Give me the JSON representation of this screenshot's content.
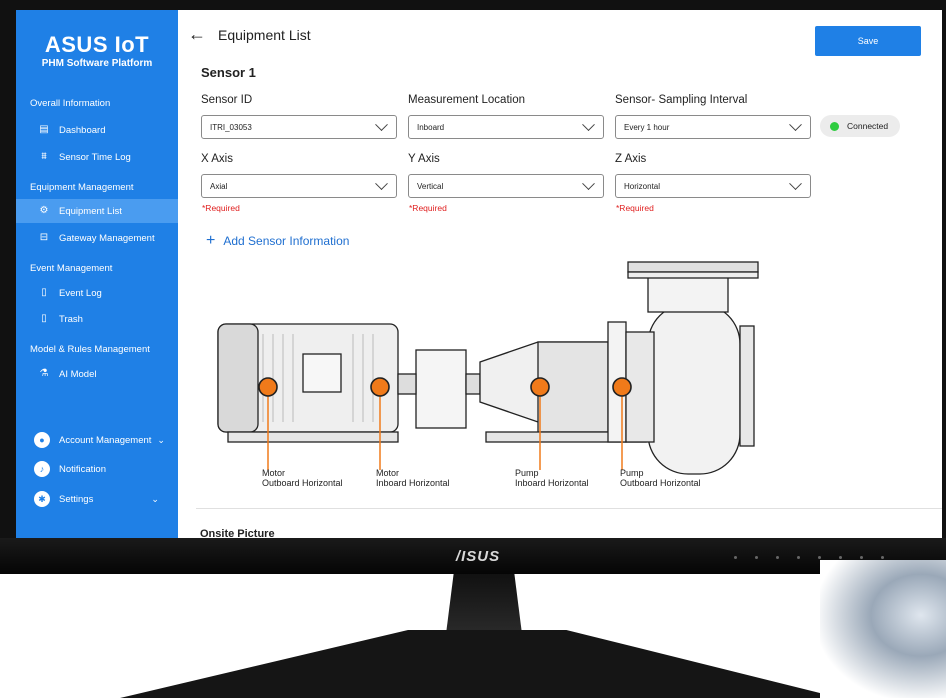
{
  "brand": {
    "name": "ASUS IoT",
    "subtitle": "PHM Software Platform"
  },
  "sidebar": {
    "sections": [
      {
        "title": "Overall Information"
      },
      {
        "title": "Equipment Management"
      },
      {
        "title": "Event Management"
      },
      {
        "title": "Model & Rules Management"
      }
    ],
    "items": [
      {
        "label": "Dashboard",
        "icon": "dashboard-icon"
      },
      {
        "label": "Sensor Time Log",
        "icon": "sensor-log-icon"
      },
      {
        "label": "Equipment List",
        "icon": "equipment-icon",
        "active": true
      },
      {
        "label": "Gateway Management",
        "icon": "gateway-icon"
      },
      {
        "label": "Event Log",
        "icon": "document-icon"
      },
      {
        "label": "Trash",
        "icon": "trash-icon"
      },
      {
        "label": "AI Model",
        "icon": "ai-model-icon"
      }
    ],
    "bottom": [
      {
        "label": "Account Management",
        "icon": "user-icon"
      },
      {
        "label": "Notification",
        "icon": "bell-icon"
      },
      {
        "label": "Settings",
        "icon": "gear-icon"
      }
    ]
  },
  "header": {
    "title": "Equipment List",
    "save_label": "Save"
  },
  "sensor": {
    "heading": "Sensor 1",
    "fields": {
      "sensor_id": {
        "label": "Sensor ID",
        "value": "ITRI_03053"
      },
      "location": {
        "label": "Measurement Location",
        "value": "Inboard"
      },
      "interval": {
        "label": "Sensor- Sampling Interval",
        "value": "Every 1 hour"
      },
      "x_axis": {
        "label": "X Axis",
        "value": "Axial"
      },
      "y_axis": {
        "label": "Y Axis",
        "value": "Vertical"
      },
      "z_axis": {
        "label": "Z Axis",
        "value": "Horizontal"
      }
    },
    "required_text": "*Required",
    "status": "Connected",
    "status_color": "#2ecc40"
  },
  "add_sensor_label": "Add Sensor Information",
  "points": [
    {
      "line1": "Motor",
      "line2": "Outboard Horizontal"
    },
    {
      "line1": "Motor",
      "line2": "Inboard Horizontal"
    },
    {
      "line1": "Pump",
      "line2": "Inboard Horizontal"
    },
    {
      "line1": "Pump",
      "line2": "Outboard Horizontal"
    }
  ],
  "onsite_label": "Onsite Picture",
  "monitor_logo": "/ISUS",
  "colors": {
    "accent": "#1f80e6",
    "marker": "#f07a1a",
    "required": "#e02020"
  }
}
